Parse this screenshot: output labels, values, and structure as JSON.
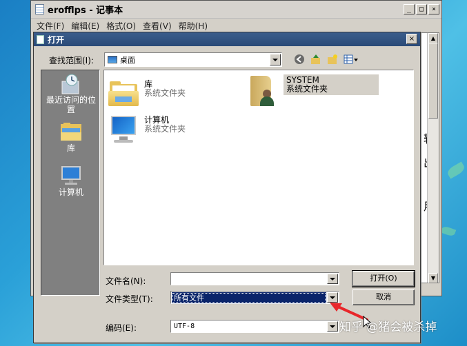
{
  "notepad": {
    "title": "erofflps - 记事本",
    "menu": [
      "文件(F)",
      "编辑(E)",
      "格式(O)",
      "查看(V)",
      "帮助(H)"
    ],
    "controls": {
      "minimize": "_",
      "maximize": "□",
      "close": "×"
    },
    "edge_text": [
      "较",
      "出",
      "用"
    ]
  },
  "dialog": {
    "title": "打开",
    "close": "×",
    "lookin_label": "查找范围(I):",
    "lookin_value": "桌面",
    "places": [
      {
        "label": "最近访问的位置",
        "icon": "recent-places-icon"
      },
      {
        "label": "库",
        "icon": "library-icon"
      },
      {
        "label": "计算机",
        "icon": "computer-icon"
      }
    ],
    "files": [
      {
        "name": "库",
        "type": "系统文件夹",
        "icon": "library-folder-icon"
      },
      {
        "name": "SYSTEM",
        "type": "系统文件夹",
        "icon": "user-folder-icon"
      },
      {
        "name": "计算机",
        "type": "系统文件夹",
        "icon": "computer-icon"
      }
    ],
    "filename_label": "文件名(N):",
    "filename_value": "",
    "filetype_label": "文件类型(T):",
    "filetype_value": "所有文件",
    "encoding_label": "编码(E):",
    "encoding_value": "UTF-8",
    "open_button": "打开(O)",
    "cancel_button": "取消"
  },
  "watermark": "知乎 @猪会被杀掉",
  "colors": {
    "selection": "#0a246a",
    "annotation_arrow": "#e8262a"
  }
}
